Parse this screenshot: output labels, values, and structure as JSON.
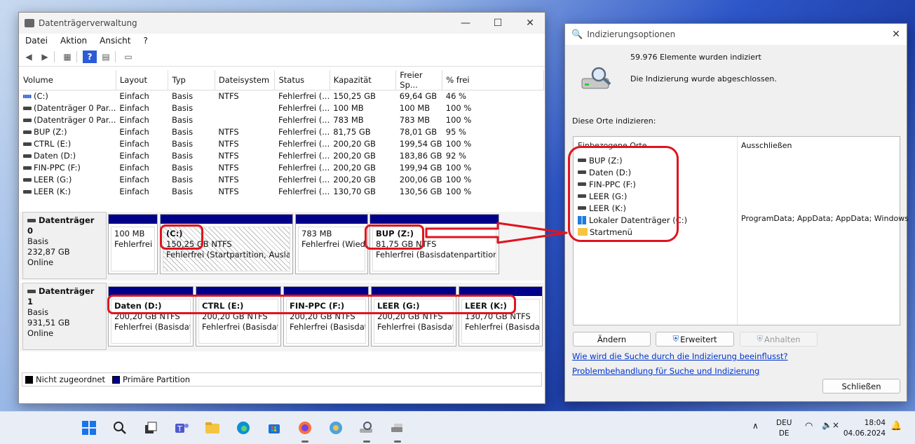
{
  "dm": {
    "title": "Datenträgerverwaltung",
    "menu": [
      "Datei",
      "Aktion",
      "Ansicht",
      "?"
    ],
    "columns": [
      "Volume",
      "Layout",
      "Typ",
      "Dateisystem",
      "Status",
      "Kapazität",
      "Freier Sp...",
      "% frei"
    ],
    "rows": [
      [
        "(C:)",
        "Einfach",
        "Basis",
        "NTFS",
        "Fehlerfrei (...",
        "150,25 GB",
        "69,64 GB",
        "46 %"
      ],
      [
        "(Datenträger 0 Par...",
        "Einfach",
        "Basis",
        "",
        "Fehlerfrei (...",
        "100 MB",
        "100 MB",
        "100 %"
      ],
      [
        "(Datenträger 0 Par...",
        "Einfach",
        "Basis",
        "",
        "Fehlerfrei (...",
        "783 MB",
        "783 MB",
        "100 %"
      ],
      [
        "BUP (Z:)",
        "Einfach",
        "Basis",
        "NTFS",
        "Fehlerfrei (...",
        "81,75 GB",
        "78,01 GB",
        "95 %"
      ],
      [
        "CTRL (E:)",
        "Einfach",
        "Basis",
        "NTFS",
        "Fehlerfrei (...",
        "200,20 GB",
        "199,54 GB",
        "100 %"
      ],
      [
        "Daten (D:)",
        "Einfach",
        "Basis",
        "NTFS",
        "Fehlerfrei (...",
        "200,20 GB",
        "183,86 GB",
        "92 %"
      ],
      [
        "FIN-PPC (F:)",
        "Einfach",
        "Basis",
        "NTFS",
        "Fehlerfrei (...",
        "200,20 GB",
        "199,94 GB",
        "100 %"
      ],
      [
        "LEER (G:)",
        "Einfach",
        "Basis",
        "NTFS",
        "Fehlerfrei (...",
        "200,20 GB",
        "200,06 GB",
        "100 %"
      ],
      [
        "LEER (K:)",
        "Einfach",
        "Basis",
        "NTFS",
        "Fehlerfrei (...",
        "130,70 GB",
        "130,56 GB",
        "100 %"
      ]
    ],
    "disk0": {
      "name": "Datenträger 0",
      "type": "Basis",
      "size": "232,87 GB",
      "state": "Online",
      "parts": [
        {
          "name": "",
          "size": "100 MB",
          "status": "Fehlerfrei (I"
        },
        {
          "name": "(C:)",
          "size": "150,25 GB NTFS",
          "status": "Fehlerfrei (Startpartition, Auslager"
        },
        {
          "name": "",
          "size": "783 MB",
          "status": "Fehlerfrei (Wieder"
        },
        {
          "name": "BUP  (Z:)",
          "size": "81,75 GB NTFS",
          "status": "Fehlerfrei (Basisdatenpartition)"
        }
      ]
    },
    "disk1": {
      "name": "Datenträger 1",
      "type": "Basis",
      "size": "931,51 GB",
      "state": "Online",
      "parts": [
        {
          "name": "Daten  (D:)",
          "size": "200,20 GB NTFS",
          "status": "Fehlerfrei (Basisdater"
        },
        {
          "name": "CTRL  (E:)",
          "size": "200,20 GB NTFS",
          "status": "Fehlerfrei (Basisdater"
        },
        {
          "name": "FIN-PPC  (F:)",
          "size": "200,20 GB NTFS",
          "status": "Fehlerfrei (Basisdater"
        },
        {
          "name": "LEER  (G:)",
          "size": "200,20 GB NTFS",
          "status": "Fehlerfrei (Basisdater"
        },
        {
          "name": "LEER  (K:)",
          "size": "130,70 GB NTFS",
          "status": "Fehlerfrei (Basisdate"
        }
      ]
    },
    "legend": {
      "unallocated": "Nicht zugeordnet",
      "primary": "Primäre Partition"
    }
  },
  "idx": {
    "title": "Indizierungsoptionen",
    "count": "59.976 Elemente wurden indiziert",
    "status": "Die Indizierung wurde abgeschlossen.",
    "section": "Diese Orte indizieren:",
    "col_included": "Einbezogene Orte",
    "col_excluded": "Ausschließen",
    "locations": [
      "BUP (Z:)",
      "Daten (D:)",
      "FIN-PPC (F:)",
      "LEER (G:)",
      "LEER (K:)",
      "Lokaler Datenträger (C:)",
      "Startmenü"
    ],
    "excluded_c": "ProgramData; AppData; AppData; Windows",
    "btn_change": "Ändern",
    "btn_advanced": "Erweitert",
    "btn_pause": "Anhalten",
    "link1": "Wie wird die Suche durch die Indizierung beeinflusst?",
    "link2": "Problembehandlung für Suche und Indizierung",
    "btn_close": "Schließen"
  },
  "tray": {
    "lang1": "DEU",
    "lang2": "DE",
    "time": "18:04",
    "date": "04.06.2024"
  },
  "colors": {
    "primary_partition": "#00008b",
    "annotation": "#e0141e"
  }
}
